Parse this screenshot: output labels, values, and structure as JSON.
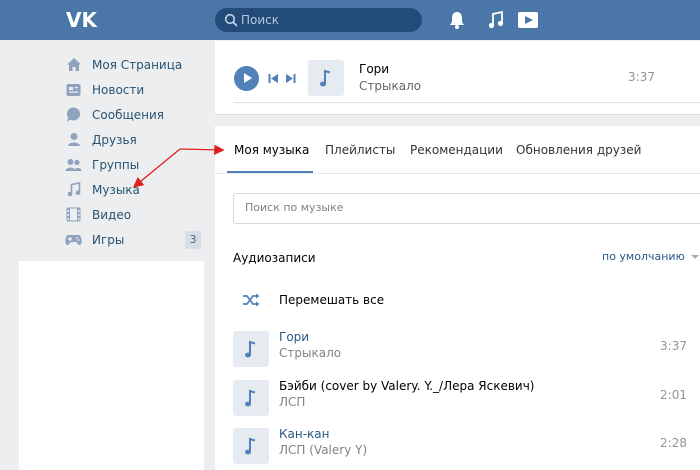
{
  "header": {
    "logo_icon": "vk-logo-icon",
    "search": {
      "placeholder": "Поиск",
      "value": ""
    },
    "icons": [
      "bell-icon",
      "music-note-icon",
      "play-square-icon"
    ],
    "background_color": "#4a76a8"
  },
  "sidebar": {
    "items": [
      {
        "label": "Моя Страница",
        "icon": "home-icon"
      },
      {
        "label": "Новости",
        "icon": "news-icon"
      },
      {
        "label": "Сообщения",
        "icon": "chat-bubble-icon"
      },
      {
        "label": "Друзья",
        "icon": "person-icon"
      },
      {
        "label": "Группы",
        "icon": "group-icon"
      },
      {
        "label": "Музыка",
        "icon": "music-note-icon"
      },
      {
        "label": "Видео",
        "icon": "film-icon"
      },
      {
        "label": "Игры",
        "icon": "gamepad-icon",
        "badge": "3"
      }
    ]
  },
  "player": {
    "title": "Гори",
    "artist": "Стрыкало",
    "duration": "3:37",
    "icons": [
      "play-icon",
      "previous-track-icon",
      "next-track-icon",
      "music-note-icon"
    ]
  },
  "main": {
    "tabs": [
      {
        "label": "Моя музыка",
        "active": true
      },
      {
        "label": "Плейлисты"
      },
      {
        "label": "Рекомендации"
      },
      {
        "label": "Обновления друзей"
      }
    ],
    "search_placeholder": "Поиск по музыке",
    "section_title": "Аудиозаписи",
    "sort_label": "по умолчанию",
    "shuffle_label": "Перемешать все",
    "tracks": [
      {
        "title": "Гори",
        "artist": "Стрыкало",
        "duration": "3:37"
      },
      {
        "title": "Бэйби (cover by Valery. Y._/Лера Яскевич)",
        "artist": "ЛСП",
        "duration": "2:01"
      },
      {
        "title": "Кан-кан",
        "artist": "ЛСП (Valery Y)",
        "duration": "2:28"
      }
    ]
  },
  "colors": {
    "accent": "#5181b8",
    "link": "#2a5885",
    "annotation_arrow": "#e02020"
  }
}
